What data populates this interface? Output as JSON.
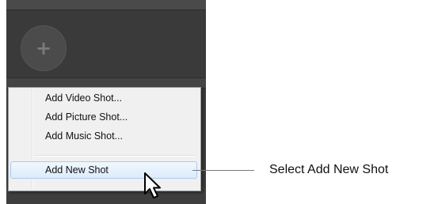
{
  "app": {
    "add_button_glyph": "+"
  },
  "context_menu": {
    "items": [
      {
        "label": "Add Video Shot..."
      },
      {
        "label": "Add Picture Shot..."
      },
      {
        "label": "Add Music Shot..."
      },
      {
        "label": "Add New Shot",
        "highlighted": true
      }
    ]
  },
  "callout": {
    "text": "Select Add New Shot"
  },
  "colors": {
    "panel_background": "#3a3a3a",
    "menu_background": "#f0f0f0",
    "highlight_fill": "#dcebfc",
    "highlight_border": "#a8cbf1"
  },
  "icons": {
    "add": "plus-icon",
    "cursor": "mouse-pointer-icon"
  }
}
